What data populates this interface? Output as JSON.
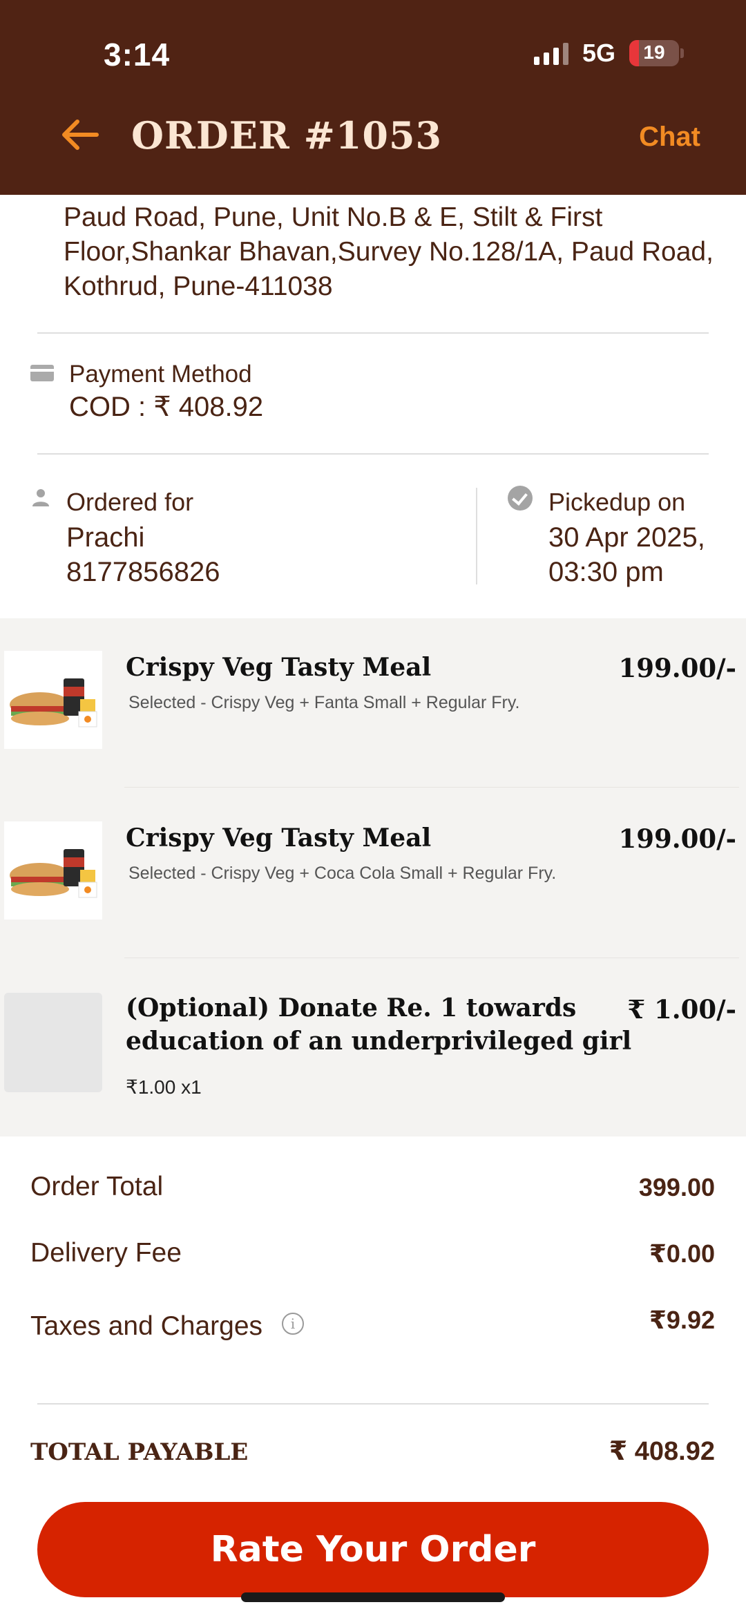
{
  "status_bar": {
    "time": "3:14",
    "network": "5G",
    "battery": "19",
    "battery_level_percent": 19
  },
  "header": {
    "title": "ORDER #1053",
    "chat_label": "Chat"
  },
  "address": {
    "text": "Paud Road, Pune,  Unit No.B & E, Stilt  & First Floor,Shankar Bhavan,Survey No.128/1A, Paud Road, Kothrud, Pune-411038"
  },
  "payment": {
    "label": "Payment Method",
    "value": "COD : ₹ 408.92"
  },
  "ordered_for": {
    "label": "Ordered for",
    "name": "Prachi",
    "phone": "8177856826"
  },
  "pickup": {
    "label": "Pickedup on",
    "date": "30 Apr 2025,",
    "time": "03:30 pm"
  },
  "items": [
    {
      "title": "Crispy Veg Tasty Meal",
      "subtitle": "Selected - Crispy Veg + Fanta Small + Regular Fry.",
      "price": "199.00/-"
    },
    {
      "title": "Crispy Veg Tasty Meal",
      "subtitle": "Selected - Crispy Veg + Coca Cola Small + Regular Fry.",
      "price": "199.00/-"
    },
    {
      "title_line1": "(Optional) Donate Re. 1 towards",
      "title_line2": "education of an underprivileged girl",
      "qty": "₹1.00 x1",
      "price": "₹ 1.00/-"
    }
  ],
  "totals": {
    "order_total_label": "Order Total",
    "order_total": "399.00",
    "delivery_fee_label": "Delivery Fee",
    "delivery_fee": "₹0.00",
    "taxes_label": "Taxes and Charges",
    "taxes": "₹9.92",
    "info_glyph": "i",
    "total_payable_label": "TOTAL PAYABLE",
    "total_payable": "₹ 408.92"
  },
  "action": {
    "rate_label": "Rate Your Order"
  },
  "colors": {
    "header_bg": "#502314",
    "accent_orange": "#f28b23",
    "button_red": "#d62300",
    "text_brown": "#4a2414"
  }
}
